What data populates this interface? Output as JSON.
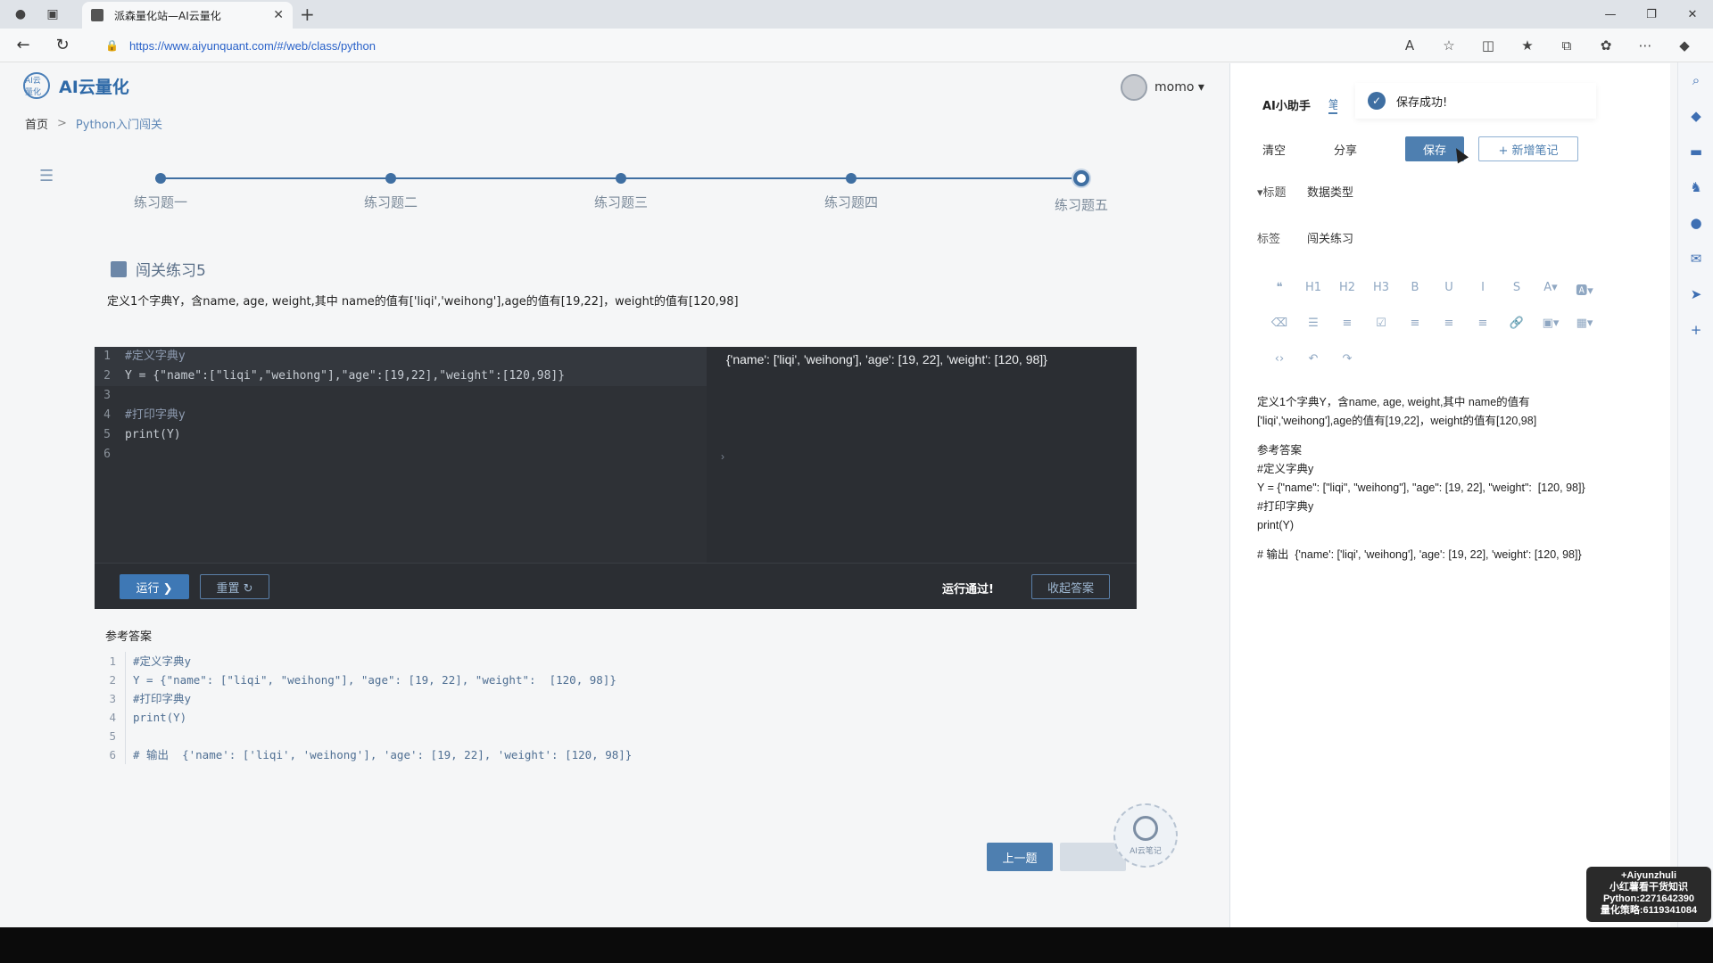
{
  "browser": {
    "tab_title": "派森量化站—AI云量化",
    "url": "https://www.aiyunquant.com/#/web/class/python"
  },
  "header": {
    "logo_text": "AI云量化",
    "logo_mark": "AI云量化",
    "username": "momo ▾"
  },
  "breadcrumb": {
    "home": "首页",
    "sep": ">",
    "current": "Python入门闯关"
  },
  "steps": [
    "练习题一",
    "练习题二",
    "练习题三",
    "练习题四",
    "练习题五"
  ],
  "exercise": {
    "title": "闯关练习5",
    "description": "定义1个字典Y，含name, age, weight,其中 name的值有['liqi','weihong'],age的值有[19,22]，weight的值有[120,98]"
  },
  "editor": {
    "lines": [
      {
        "n": "1",
        "text": "#定义字典y",
        "comment": true
      },
      {
        "n": "2",
        "text": "Y = {\"name\":[\"liqi\",\"weihong\"],\"age\":[19,22],\"weight\":[120,98]}",
        "comment": false
      },
      {
        "n": "3",
        "text": "",
        "comment": false
      },
      {
        "n": "4",
        "text": "#打印字典y",
        "comment": true
      },
      {
        "n": "5",
        "text": "print(Y)",
        "comment": false
      },
      {
        "n": "6",
        "text": "",
        "comment": false
      }
    ],
    "output": "{'name': ['liqi', 'weihong'], 'age': [19, 22], 'weight': [120, 98]}",
    "run_label": "运行 ❯",
    "reset_label": "重置 ↻",
    "status": "运行通过!",
    "collapse_label": "收起答案"
  },
  "answer": {
    "title": "参考答案",
    "lines": [
      {
        "n": "1",
        "text": "#定义字典y"
      },
      {
        "n": "2",
        "text": "Y = {\"name\": [\"liqi\", \"weihong\"], \"age\": [19, 22], \"weight\":  [120, 98]}"
      },
      {
        "n": "3",
        "text": "#打印字典y"
      },
      {
        "n": "4",
        "text": "print(Y)"
      },
      {
        "n": "5",
        "text": ""
      },
      {
        "n": "6",
        "text": "# 输出  {'name': ['liqi', 'weihong'], 'age': [19, 22], 'weight': [120, 98]}"
      }
    ]
  },
  "footer_nav": {
    "prev_label": "上一题",
    "ai_note_label": "AI云笔记"
  },
  "panel": {
    "tab_assistant": "AI小助手",
    "tab_note": "笔",
    "toast": "保存成功!",
    "clear_label": "清空",
    "share_label": "分享",
    "save_label": "保存",
    "add_note_label": "+ 新增笔记",
    "title_key": "▾标题",
    "title_value": "数据类型",
    "tag_key": "标签",
    "tag_value": "闯关练习",
    "note_lines": [
      "定义1个字典Y，含name, age, weight,其中 name的值有",
      "['liqi','weihong'],age的值有[19,22]，weight的值有[120,98]",
      "",
      "参考答案",
      "#定义字典y",
      "Y = {\"name\": [\"liqi\", \"weihong\"], \"age\": [19, 22], \"weight\":  [120, 98]}",
      "#打印字典y",
      "print(Y)",
      "",
      "# 输出  {'name': ['liqi', 'weihong'], 'age': [19, 22], 'weight': [120, 98]}"
    ]
  },
  "watermark": [
    "+Aiyunzhuli",
    "小红薯看干货知识",
    "Python:2271642390",
    "量化策略:6119341084"
  ]
}
